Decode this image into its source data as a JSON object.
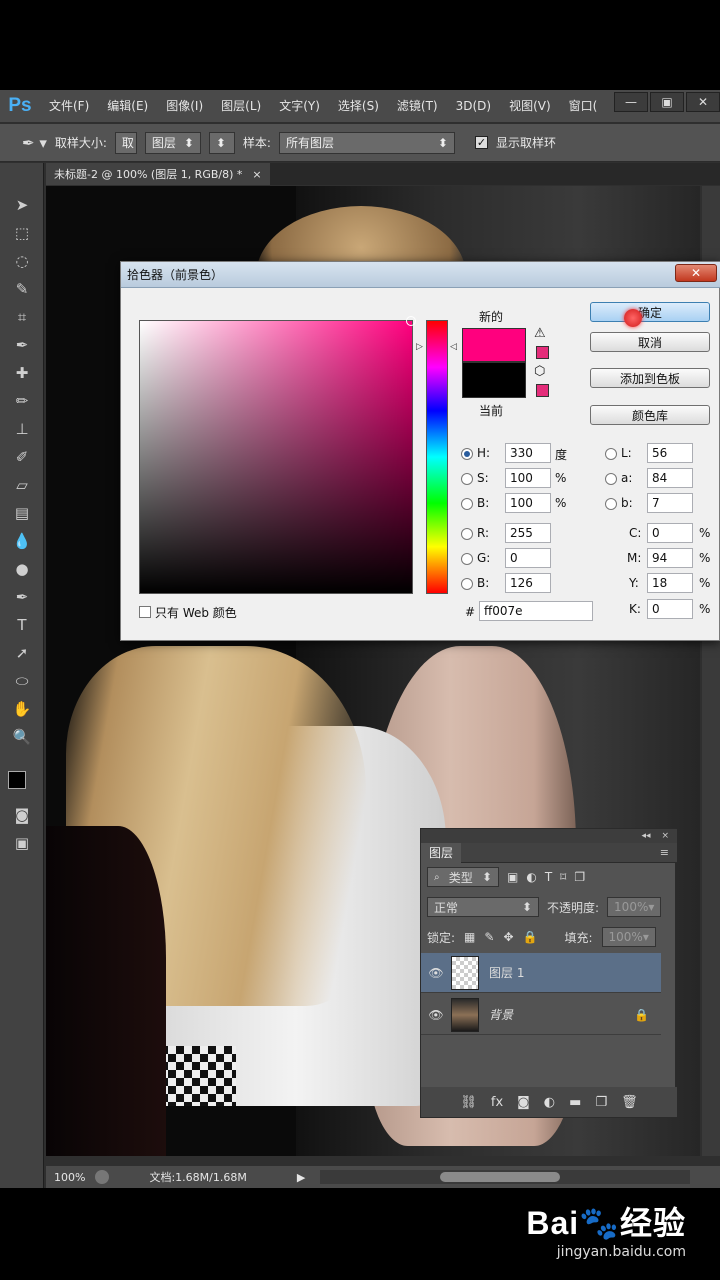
{
  "app": {
    "logo": "Ps",
    "menus": [
      "文件(F)",
      "编辑(E)",
      "图像(I)",
      "图层(L)",
      "文字(Y)",
      "选择(S)",
      "滤镜(T)",
      "3D(D)",
      "视图(V)",
      "窗口("
    ],
    "window_controls": [
      "—",
      "▣",
      "✕"
    ]
  },
  "options": {
    "sample_size_label": "取样大小:",
    "sample_size_value": "取",
    "layer_select": "图层",
    "sample_label": "样本:",
    "sample_value": "所有图层",
    "show_ring_label": "显示取样环",
    "show_ring_checked": true
  },
  "document": {
    "tab_title": "未标题-2 @ 100% (图层 1, RGB/8) *",
    "tab_close": "×"
  },
  "status": {
    "zoom": "100%",
    "doc_size": "文档:1.68M/1.68M"
  },
  "picker": {
    "title": "拾色器（前景色）",
    "close": "✕",
    "new_label": "新的",
    "current_label": "当前",
    "new_color": "#ff007e",
    "current_color": "#000000",
    "buttons": {
      "ok": "确定",
      "cancel": "取消",
      "add_swatch": "添加到色板",
      "library": "颜色库"
    },
    "hsb": {
      "h_label": "H:",
      "h": "330",
      "h_unit": "度",
      "s_label": "S:",
      "s": "100",
      "s_unit": "%",
      "b_label": "B:",
      "b": "100",
      "b_unit": "%"
    },
    "rgb": {
      "r_label": "R:",
      "r": "255",
      "g_label": "G:",
      "g": "0",
      "b_label": "B:",
      "b": "126"
    },
    "lab": {
      "l_label": "L:",
      "l": "56",
      "a_label": "a:",
      "a": "84",
      "b_label": "b:",
      "b": "7"
    },
    "cmyk": {
      "c_label": "C:",
      "c": "0",
      "m_label": "M:",
      "m": "94",
      "y_label": "Y:",
      "y": "18",
      "k_label": "K:",
      "k": "0",
      "unit": "%"
    },
    "hex_label": "#",
    "hex": "ff007e",
    "web_only_label": "只有 Web 颜色"
  },
  "layers": {
    "title": "图层",
    "collapse": "◂◂",
    "close": "×",
    "filter_type": "类型",
    "blend_mode": "正常",
    "opacity_label": "不透明度:",
    "opacity": "100%",
    "lock_label": "锁定:",
    "fill_label": "填充:",
    "fill": "100%",
    "items": [
      {
        "name": "图层 1",
        "selected": true
      },
      {
        "name": "背景",
        "locked": true
      }
    ],
    "bottom_icons": [
      "link-icon",
      "fx-icon",
      "mask-icon",
      "adjustment-icon",
      "group-icon",
      "new-layer-icon",
      "trash-icon"
    ]
  },
  "watermark": {
    "logo": "Bai🐾经验",
    "url": "jingyan.baidu.com"
  }
}
